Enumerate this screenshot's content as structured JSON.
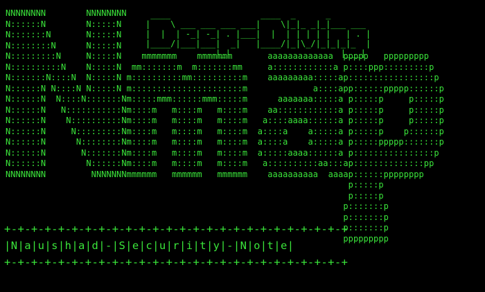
{
  "terminal": {
    "text_color": "#3ae43a",
    "background": "#000000",
    "art_lines": [
      "NNNNNNNN        NNNNNNNN",
      "N::::::N        N:::::N",
      "N:::::::N       N:::::N",
      "N::::::::N      N:::::N",
      "N:::::::::N     N:::::N    mmmmmmm    mmmmmmm       aaaaaaaaaaaaa  ppppp   ppppppppp",
      "N::::::::::N    N:::::N  mm:::::::m  m:::::::mm     a::::::::::::a p::::ppp:::::::::p",
      "N:::::::N::::N  N:::::N m::::::::::mm::::::::::m    aaaaaaaaa:::::ap:::::::::::::::::p",
      "N::::::N N::::N N:::::N m::::::::::::::::::::::m             a::::app::::::ppppp::::::p",
      "N::::::N  N::::N:::::::Nm:::::mmm::::::mmm:::::m      aaaaaaa:::::a p:::::p     p:::::p",
      "N::::::N   N:::::::::::Nm::::m   m::::m   m::::m    aa::::::::::::a p:::::p     p:::::p",
      "N::::::N    N::::::::::Nm::::m   m::::m   m::::m   a::::aaaa::::::a p:::::p     p:::::p",
      "N::::::N     N:::::::::Nm::::m   m::::m   m::::m  a::::a    a:::::a p:::::p    p::::::p",
      "N::::::N      N::::::::Nm::::m   m::::m   m::::m  a::::a    a:::::a p:::::ppppp:::::::p",
      "N::::::N       N:::::::Nm::::m   m::::m   m::::m  a:::::aaaa::::::a p::::::::::::::::p",
      "N::::::N        N::::::Nm::::m   m::::m   m::::m   a::::::::::aa:::ap::::::::::::::pp",
      "NNNNNNNN         NNNNNNNmmmmmm   mmmmmm   mmmmmm    aaaaaaaaaa  aaaap::::::pppppppp",
      "                                                                    p:::::p",
      "                                                                    p:::::p",
      "                                                                   p:::::::p",
      "                                                                   p:::::::p",
      "                                                                   p:::::::p",
      "                                                                   ppppppppp"
    ],
    "title_art": " ____                  ____  _      _               \n|    \\ ___ ___ ___ ___|    \\|_|_ _|_|___ ___       \n|  |  | -_| -_| . |___|  |  | | | | |   | . |      \n|____/|___|___|  _|   |____/|_|\\_/|_|_|_|_  |      \n              |_|                      |___|      ",
    "banner": {
      "border": "+-+-+-+-+-+-+-+-+-+-+-+-+-+-+-+-+-+-+-+-+-+-+-+-+-+",
      "text": "|N|a|u|s|h|a|d|-|S|e|c|u|r|i|t|y|-|N|o|t|e|"
    }
  }
}
